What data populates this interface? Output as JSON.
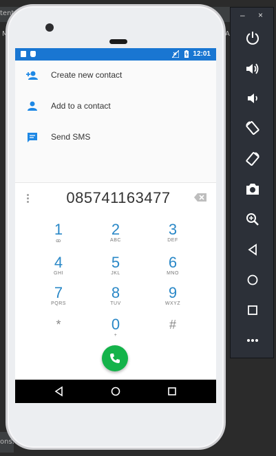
{
  "ide": {
    "tab_left": "tent",
    "tab_mid": "Ma",
    "tab_right": "A",
    "bottom_text": "ons."
  },
  "status_bar": {
    "time": "12:01",
    "color": "#1976d2"
  },
  "contact_actions": [
    {
      "label": "Create new contact",
      "icon": "add-person-icon"
    },
    {
      "label": "Add to a contact",
      "icon": "person-icon"
    },
    {
      "label": "Send SMS",
      "icon": "message-icon"
    }
  ],
  "dialer": {
    "number": "085741163477",
    "keys": [
      {
        "digit": "1",
        "letters": "ꝏ"
      },
      {
        "digit": "2",
        "letters": "ABC"
      },
      {
        "digit": "3",
        "letters": "DEF"
      },
      {
        "digit": "4",
        "letters": "GHI"
      },
      {
        "digit": "5",
        "letters": "JKL"
      },
      {
        "digit": "6",
        "letters": "MNO"
      },
      {
        "digit": "7",
        "letters": "PQRS"
      },
      {
        "digit": "8",
        "letters": "TUV"
      },
      {
        "digit": "9",
        "letters": "WXYZ"
      },
      {
        "digit": "*",
        "letters": ""
      },
      {
        "digit": "0",
        "letters": "+"
      },
      {
        "digit": "#",
        "letters": ""
      }
    ],
    "accent_color": "#2a88c7",
    "call_color": "#14b34a"
  },
  "emulator_toolbar": {
    "minimize": "–",
    "close": "×",
    "buttons": [
      "power-icon",
      "volume-up-icon",
      "volume-down-icon",
      "rotate-left-icon",
      "rotate-right-icon",
      "camera-icon",
      "zoom-icon",
      "back-icon",
      "home-icon",
      "overview-icon",
      "more-icon"
    ]
  }
}
